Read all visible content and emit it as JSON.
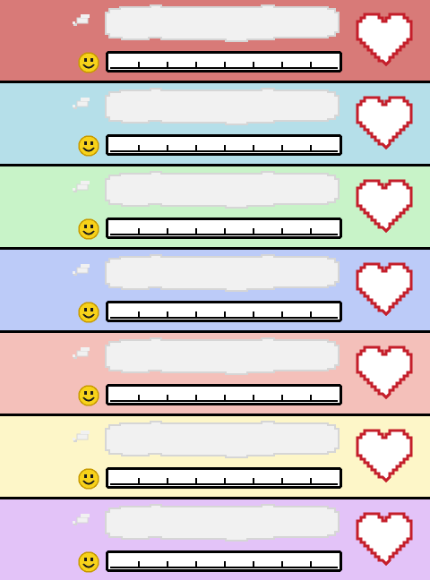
{
  "rows": [
    {
      "background": "#d87a78",
      "mood_level": 0,
      "heart_fill": 1
    },
    {
      "background": "#b5dfe9",
      "mood_level": 0,
      "heart_fill": 1
    },
    {
      "background": "#c8f3c8",
      "mood_level": 0,
      "heart_fill": 1
    },
    {
      "background": "#bccbf8",
      "mood_level": 0,
      "heart_fill": 1
    },
    {
      "background": "#f4c0ba",
      "mood_level": 0,
      "heart_fill": 1
    },
    {
      "background": "#fdf6c8",
      "mood_level": 0,
      "heart_fill": 1
    },
    {
      "background": "#e3c3f8",
      "mood_level": 0,
      "heart_fill": 1
    }
  ],
  "icons": {
    "thought": "thought-bubble-icon",
    "mood": "smiley-face-icon",
    "heart": "heart-icon"
  },
  "colors": {
    "separator": "#000000",
    "bubble_fill": "#f1f1f1",
    "bubble_outline": "#d6d6d6",
    "meter_fill": "#ffffff",
    "meter_border": "#000000",
    "smiley": "#f7d21a",
    "heart_outline": "#c41e2a",
    "heart_fill": "#ffffff"
  }
}
